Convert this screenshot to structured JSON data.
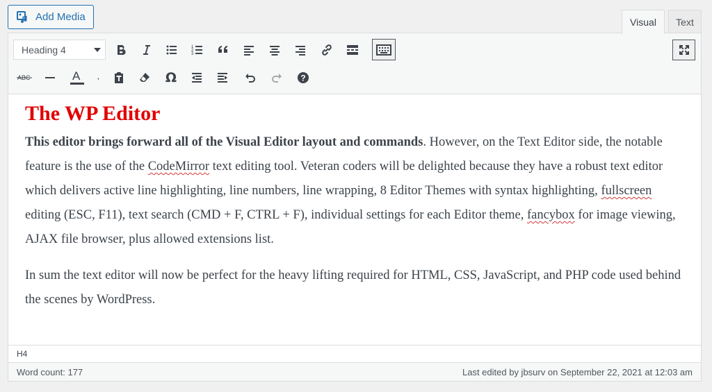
{
  "media": {
    "add_label": "Add Media",
    "icon": "media-icon"
  },
  "mode_tabs": {
    "visual": "Visual",
    "text": "Text",
    "active": "visual"
  },
  "toolbar": {
    "format_value": "Heading 4",
    "row1": [
      "bold-icon",
      "italic-icon",
      "bullet-list-icon",
      "numbered-list-icon",
      "blockquote-icon",
      "align-left-icon",
      "align-center-icon",
      "align-right-icon",
      "link-icon",
      "read-more-icon",
      "toolbar-toggle-icon"
    ],
    "row2": [
      "strikethrough-icon",
      "horizontal-line-icon",
      "text-color-icon",
      "paste-text-icon",
      "clear-formatting-icon",
      "special-character-icon",
      "outdent-icon",
      "indent-icon",
      "undo-icon",
      "redo-icon",
      "help-icon"
    ],
    "fullscreen": "fullscreen-icon",
    "text_color_letter": "A",
    "strikethrough_letters": "ABC",
    "omega": "Ω",
    "help": "?"
  },
  "content": {
    "heading": "The WP Editor",
    "p1_bold": "This editor brings forward all of the Visual Editor layout and commands",
    "p1_a": ". However, on the Text Editor side, the  notable feature  is the use of the ",
    "p1_codemirror": "CodeMirror",
    "p1_b": " text editing tool. Veteran coders will be delighted because they have a robust text editor  which delivers  active line highlighting, line numbers, line wrapping, 8 Editor Themes with syntax highlighting, ",
    "p1_fullscreen": "fullscreen",
    "p1_c": " editing (ESC, F11), text search (CMD + F, CTRL + F), individual settings for each Editor theme, ",
    "p1_fancybox": "fancybox",
    "p1_d": " for image viewing, AJAX file browser, plus allowed extensions list.",
    "p2": "In sum the text editor will now be perfect for the heavy lifting required for HTML, CSS, JavaScript, and PHP code used behind the scenes by WordPress."
  },
  "path": "H4",
  "status": {
    "word_count": "Word count: 177",
    "last_edited": "Last edited by jbsurv on September 22, 2021 at 12:03 am"
  },
  "colors": {
    "accent": "#2271b1",
    "heading": "#e20000",
    "spellcheck": "#d63638"
  }
}
